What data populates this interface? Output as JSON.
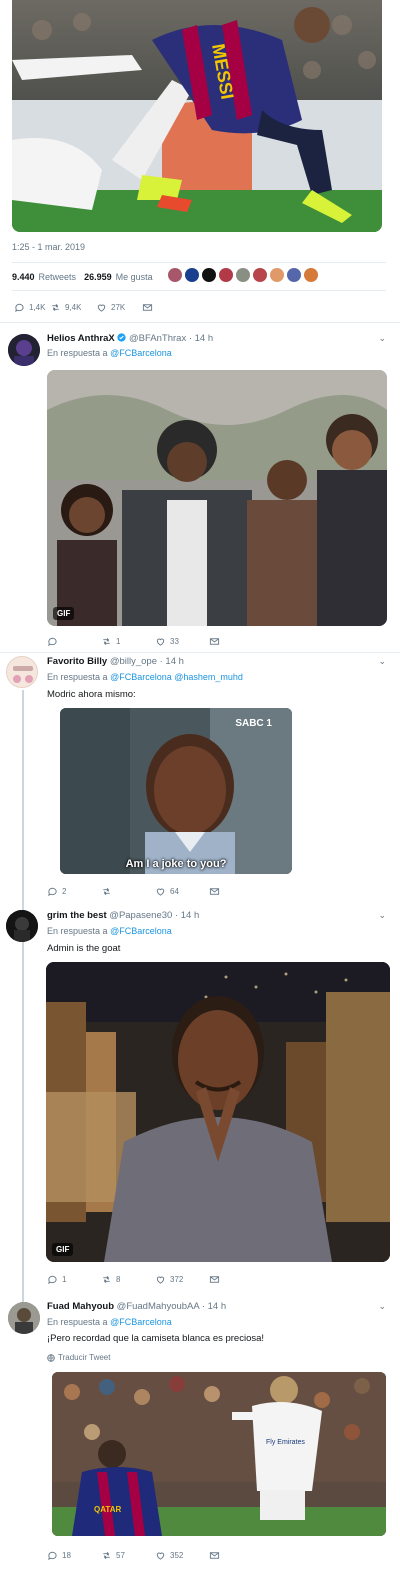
{
  "main_tweet": {
    "timestamp": "1:25 - 1 mar. 2019",
    "retweets_count": "9.440",
    "retweets_label": "Retweets",
    "likes_count": "26.959",
    "likes_label": "Me gusta",
    "actions": {
      "replies": "1,4K",
      "retweets": "9,4K",
      "likes": "27K"
    },
    "photo_text": "MESSI"
  },
  "replies": [
    {
      "name": "Helios AnthraX",
      "handle": "@BFAnThrax",
      "time": "· 14 h",
      "reply_prefix": "En respuesta a",
      "reply_to": "@FCBarcelona",
      "text": "",
      "badge": "GIF",
      "actions": {
        "replies": "",
        "retweets": "1",
        "likes": "33"
      }
    },
    {
      "name": "Favorito Billy",
      "handle": "@billy_ope",
      "time": "· 14 h",
      "reply_prefix": "En respuesta a",
      "reply_to": "@FCBarcelona",
      "reply_to_2": "@hashem_muhd",
      "text": "Modric ahora mismo:",
      "caption": "Am I a joke to you?",
      "channel_logo": "SABC 1",
      "actions": {
        "replies": "2",
        "retweets": "",
        "likes": "64"
      }
    },
    {
      "name": "grim the best",
      "handle": "@Papasene30",
      "time": "· 14 h",
      "reply_prefix": "En respuesta a",
      "reply_to": "@FCBarcelona",
      "text": "Admin is the goat",
      "badge": "GIF",
      "actions": {
        "replies": "1",
        "retweets": "8",
        "likes": "372"
      }
    },
    {
      "name": "Fuad Mahyoub",
      "handle": "@FuadMahyoubAA",
      "time": "· 14 h",
      "reply_prefix": "En respuesta a",
      "reply_to": "@FCBarcelona",
      "text": "¡Pero recordad que la camiseta blanca es preciosa!",
      "translate": "Traducir Tweet",
      "photo_texts": [
        "Fly Emirates",
        "QATAR"
      ],
      "actions": {
        "replies": "18",
        "retweets": "57",
        "likes": "352"
      }
    }
  ],
  "colors": {
    "accent": "#1b95e0",
    "thread_line": "#ccd6dd",
    "muted": "#657786",
    "pitch": "#3f8f3a"
  }
}
